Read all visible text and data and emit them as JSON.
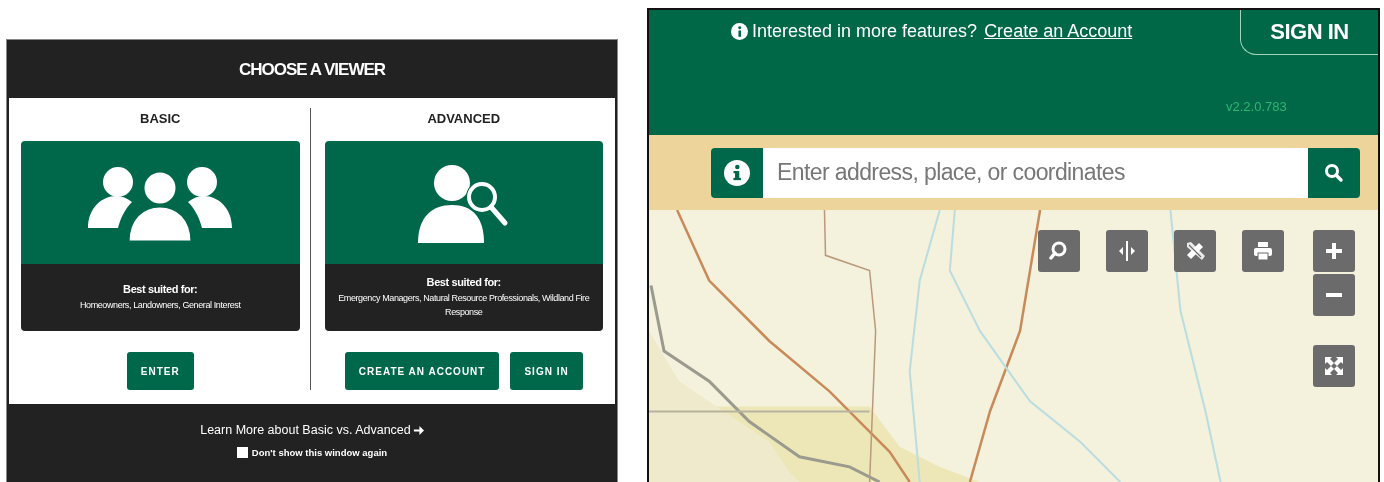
{
  "viewer_dialog": {
    "title": "CHOOSE A VIEWER",
    "options": [
      {
        "heading": "BASIC",
        "kind": "group",
        "suited_label": "Best suited for:",
        "suited_for": "Homeowners, Landowners, General Interest",
        "buttons": [
          "ENTER"
        ]
      },
      {
        "heading": "ADVANCED",
        "kind": "search-user",
        "suited_label": "Best suited for:",
        "suited_for": "Emergency Managers, Natural Resource Professionals, Wildland Fire Response",
        "buttons": [
          "CREATE AN ACCOUNT",
          "SIGN IN"
        ]
      }
    ],
    "learn_more": "Learn More about Basic vs. Advanced",
    "dont_show": {
      "label": "Don't show this window again",
      "checked": false
    }
  },
  "map_viewer": {
    "banner": "Interested in more features?",
    "banner_link": "Create an Account",
    "sign_in": "SIGN IN",
    "version": "v2.2.0.783",
    "search": {
      "placeholder": "Enter address, place, or coordinates"
    },
    "tools": [
      {
        "kind": "search"
      },
      {
        "kind": "swipe"
      },
      {
        "kind": "draw"
      },
      {
        "kind": "print"
      }
    ],
    "zoom": [
      {
        "kind": "plus"
      },
      {
        "kind": "minus"
      }
    ],
    "extent": {
      "kind": "fullscreen"
    }
  }
}
